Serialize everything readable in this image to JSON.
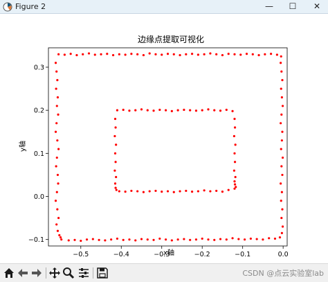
{
  "window": {
    "title": "Figure 2",
    "minimize_glyph": "—",
    "maximize_glyph": "☐",
    "close_glyph": "✕"
  },
  "toolbar": {
    "buttons": [
      {
        "name": "home-icon",
        "label": "Home"
      },
      {
        "name": "back-icon",
        "label": "Back"
      },
      {
        "name": "forward-icon",
        "label": "Forward"
      },
      {
        "name": "pan-icon",
        "label": "Pan"
      },
      {
        "name": "zoom-icon",
        "label": "Zoom"
      },
      {
        "name": "configure-subplots-icon",
        "label": "Subplots"
      },
      {
        "name": "save-icon",
        "label": "Save"
      }
    ]
  },
  "watermark": "CSDN @点云实验室lab",
  "colors": {
    "points": "#ff0000",
    "titlebar": "#e7f1f8",
    "toolbar": "#f0f0f0"
  },
  "chart_data": {
    "type": "scatter",
    "title": "边缘点提取可视化",
    "xlabel": "x轴",
    "ylabel": "y轴",
    "xlim": [
      -0.58,
      0.01
    ],
    "ylim": [
      -0.115,
      0.345
    ],
    "xticks": [
      -0.5,
      -0.4,
      -0.3,
      -0.2,
      -0.1,
      0.0
    ],
    "xtick_labels": [
      "−0.5",
      "−0.4",
      "−0.3",
      "−0.2",
      "−0.1",
      "0.0"
    ],
    "yticks": [
      -0.1,
      0.0,
      0.1,
      0.2,
      0.3
    ],
    "ytick_labels": [
      "−0.1",
      "0.0",
      "0.1",
      "0.2",
      "0.3"
    ],
    "grid": false,
    "series": [
      {
        "color": "#ff0000",
        "x": [
          -0.555,
          -0.54,
          -0.525,
          -0.51,
          -0.495,
          -0.48,
          -0.465,
          -0.45,
          -0.435,
          -0.42,
          -0.405,
          -0.39,
          -0.375,
          -0.36,
          -0.345,
          -0.33,
          -0.315,
          -0.3,
          -0.285,
          -0.27,
          -0.255,
          -0.24,
          -0.225,
          -0.21,
          -0.195,
          -0.18,
          -0.165,
          -0.15,
          -0.135,
          -0.12,
          -0.105,
          -0.09,
          -0.075,
          -0.06,
          -0.045,
          -0.03,
          -0.015,
          -0.005,
          -0.548,
          -0.53,
          -0.515,
          -0.5,
          -0.485,
          -0.47,
          -0.455,
          -0.44,
          -0.425,
          -0.41,
          -0.395,
          -0.38,
          -0.365,
          -0.35,
          -0.335,
          -0.32,
          -0.305,
          -0.29,
          -0.275,
          -0.26,
          -0.245,
          -0.23,
          -0.215,
          -0.2,
          -0.185,
          -0.17,
          -0.155,
          -0.14,
          -0.125,
          -0.11,
          -0.095,
          -0.08,
          -0.065,
          -0.05,
          -0.035,
          -0.02,
          -0.008,
          -0.562,
          -0.56,
          -0.558,
          -0.561,
          -0.557,
          -0.559,
          -0.556,
          -0.56,
          -0.562,
          -0.558,
          -0.555,
          -0.559,
          -0.561,
          -0.557,
          -0.556,
          -0.559,
          -0.562,
          -0.558,
          -0.555,
          -0.56,
          -0.557,
          -0.553,
          -0.55,
          -0.006,
          -0.004,
          -0.002,
          -0.005,
          -0.003,
          -0.001,
          -0.004,
          -0.006,
          -0.002,
          -0.003,
          -0.005,
          -0.001,
          -0.004,
          -0.002,
          -0.006,
          -0.003,
          -0.005,
          -0.002,
          -0.004,
          -0.001,
          -0.003,
          -0.41,
          -0.395,
          -0.38,
          -0.365,
          -0.35,
          -0.335,
          -0.32,
          -0.305,
          -0.29,
          -0.275,
          -0.26,
          -0.245,
          -0.23,
          -0.215,
          -0.2,
          -0.185,
          -0.17,
          -0.155,
          -0.14,
          -0.125,
          -0.405,
          -0.39,
          -0.375,
          -0.36,
          -0.345,
          -0.33,
          -0.315,
          -0.3,
          -0.285,
          -0.27,
          -0.255,
          -0.24,
          -0.225,
          -0.21,
          -0.195,
          -0.18,
          -0.165,
          -0.15,
          -0.135,
          -0.12,
          -0.415,
          -0.414,
          -0.416,
          -0.413,
          -0.415,
          -0.414,
          -0.416,
          -0.413,
          -0.415,
          -0.414,
          -0.412,
          -0.12,
          -0.119,
          -0.121,
          -0.118,
          -0.12,
          -0.119,
          -0.121,
          -0.118,
          -0.12,
          -0.119,
          -0.117
        ],
        "y": [
          0.33,
          0.329,
          0.331,
          0.328,
          0.33,
          0.332,
          0.329,
          0.33,
          0.331,
          0.328,
          0.33,
          0.329,
          0.331,
          0.33,
          0.328,
          0.332,
          0.33,
          0.329,
          0.331,
          0.33,
          0.328,
          0.33,
          0.331,
          0.329,
          0.33,
          0.332,
          0.33,
          0.328,
          0.331,
          0.33,
          0.329,
          0.331,
          0.33,
          0.328,
          0.33,
          0.331,
          0.329,
          0.325,
          -0.1,
          -0.102,
          -0.101,
          -0.103,
          -0.1,
          -0.099,
          -0.101,
          -0.102,
          -0.1,
          -0.098,
          -0.101,
          -0.1,
          -0.102,
          -0.099,
          -0.1,
          -0.101,
          -0.098,
          -0.1,
          -0.102,
          -0.1,
          -0.099,
          -0.101,
          -0.1,
          -0.098,
          -0.1,
          -0.101,
          -0.099,
          -0.1,
          -0.097,
          -0.099,
          -0.1,
          -0.098,
          -0.099,
          -0.1,
          -0.097,
          -0.098,
          -0.095,
          0.31,
          0.29,
          0.27,
          0.25,
          0.23,
          0.21,
          0.19,
          0.17,
          0.15,
          0.13,
          0.11,
          0.09,
          0.07,
          0.05,
          0.03,
          0.01,
          -0.01,
          -0.03,
          -0.05,
          -0.065,
          -0.08,
          -0.09,
          -0.095,
          0.31,
          0.29,
          0.27,
          0.25,
          0.23,
          0.21,
          0.19,
          0.17,
          0.15,
          0.13,
          0.11,
          0.09,
          0.07,
          0.05,
          0.03,
          0.01,
          -0.01,
          -0.03,
          -0.05,
          -0.07,
          -0.085,
          0.2,
          0.201,
          0.199,
          0.2,
          0.202,
          0.2,
          0.199,
          0.201,
          0.2,
          0.198,
          0.2,
          0.201,
          0.2,
          0.199,
          0.2,
          0.202,
          0.2,
          0.199,
          0.201,
          0.198,
          0.012,
          0.011,
          0.013,
          0.012,
          0.01,
          0.012,
          0.013,
          0.011,
          0.012,
          0.01,
          0.012,
          0.013,
          0.011,
          0.012,
          0.014,
          0.012,
          0.013,
          0.011,
          0.015,
          0.018,
          0.18,
          0.16,
          0.14,
          0.12,
          0.1,
          0.08,
          0.06,
          0.045,
          0.03,
          0.02,
          0.015,
          0.18,
          0.16,
          0.14,
          0.12,
          0.1,
          0.08,
          0.06,
          0.045,
          0.035,
          0.028,
          0.022
        ]
      }
    ]
  }
}
